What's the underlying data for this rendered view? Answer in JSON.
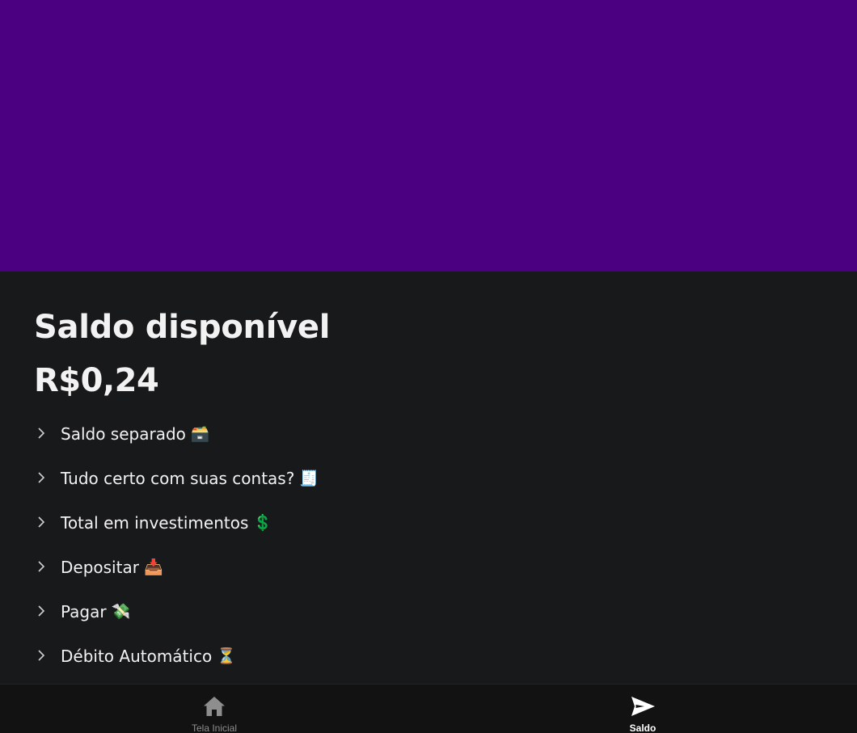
{
  "hero": {
    "background_color": "#4b0082"
  },
  "balance": {
    "title": "Saldo disponível",
    "amount": "R$0,24"
  },
  "menu": {
    "items": [
      {
        "label": "Saldo separado",
        "emoji": "🗃️",
        "icon": "card-file-box-icon"
      },
      {
        "label": "Tudo certo com suas contas?",
        "emoji": "🧾",
        "icon": "receipt-icon"
      },
      {
        "label": "Total em investimentos",
        "emoji": "💲",
        "icon": "dollar-sign-icon"
      },
      {
        "label": "Depositar",
        "emoji": "📥",
        "icon": "inbox-tray-icon"
      },
      {
        "label": "Pagar",
        "emoji": "💸",
        "icon": "money-with-wings-icon"
      },
      {
        "label": "Débito Automático",
        "emoji": "⏳",
        "icon": "hourglass-icon"
      }
    ]
  },
  "bottom_nav": {
    "tabs": [
      {
        "label": "Tela Inicial",
        "icon": "home-icon",
        "active": false
      },
      {
        "label": "Saldo",
        "icon": "send-icon",
        "active": true
      }
    ],
    "active_color": "#ffffff",
    "inactive_color": "#8e8e8e"
  }
}
